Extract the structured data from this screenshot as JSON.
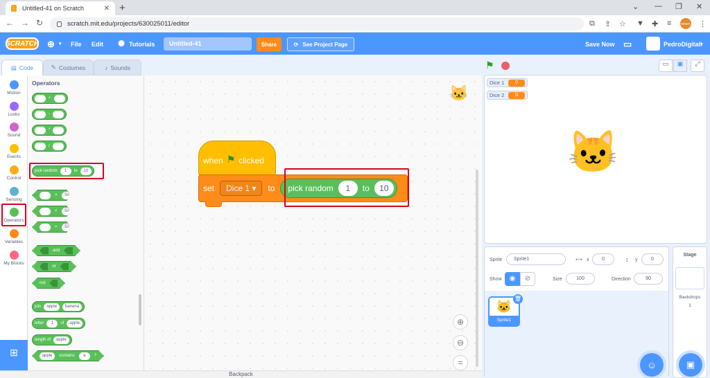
{
  "browser": {
    "tab_title": "Untitled-41 on Scratch",
    "url": "scratch.mit.edu/projects/630025011/editor",
    "profile_badge": "MAMA"
  },
  "menu": {
    "logo": "SCRATCH",
    "file": "File",
    "edit": "Edit",
    "tutorials": "Tutorials",
    "project_title": "Untitled-41",
    "share": "Share",
    "see_project_page": "See Project Page",
    "save_now": "Save Now",
    "username": "PedroDigitali"
  },
  "editor_tabs": {
    "code": "Code",
    "costumes": "Costumes",
    "sounds": "Sounds"
  },
  "categories": [
    {
      "label": "Motion",
      "color": "#4c97ff"
    },
    {
      "label": "Looks",
      "color": "#9966ff"
    },
    {
      "label": "Sound",
      "color": "#cf63cf"
    },
    {
      "label": "Events",
      "color": "#ffbf00"
    },
    {
      "label": "Control",
      "color": "#ffab19"
    },
    {
      "label": "Sensing",
      "color": "#5cb1d6"
    },
    {
      "label": "Operators",
      "color": "#59c059"
    },
    {
      "label": "Variables",
      "color": "#ff8c1a"
    },
    {
      "label": "My Blocks",
      "color": "#ff6680"
    }
  ],
  "palette": {
    "title": "Operators",
    "arith": [
      "+",
      "-",
      "*",
      "/"
    ],
    "pick_random": {
      "label": "pick random",
      "from": "1",
      "to_label": "to",
      "to": "10"
    },
    "compare": [
      {
        "op": ">",
        "value": "50"
      },
      {
        "op": "<",
        "value": "50"
      },
      {
        "op": "=",
        "value": "50"
      }
    ],
    "and": "and",
    "or": "or",
    "not": "not",
    "join": {
      "label": "join",
      "a": "apple",
      "b": "banana"
    },
    "letter": {
      "label": "letter",
      "n": "1",
      "of": "of",
      "word": "apple"
    },
    "length": {
      "label": "length of",
      "word": "apple"
    },
    "contains": {
      "word": "apple",
      "label": "contains",
      "letter": "a",
      "q": "?"
    }
  },
  "script": {
    "when": "when",
    "clicked": "clicked",
    "set": "set",
    "variable": "Dice 1",
    "to": "to",
    "pick_random": "pick random",
    "from": "1",
    "to_label": "to",
    "to_value": "10"
  },
  "backpack": "Backpack",
  "monitors": [
    {
      "name": "Dice 1",
      "value": "0"
    },
    {
      "name": "Dice 2",
      "value": "0"
    }
  ],
  "sprite_info": {
    "sprite_label": "Sprite",
    "sprite_name": "Sprite1",
    "x_label": "x",
    "x": "0",
    "y_label": "y",
    "y": "0",
    "show_label": "Show",
    "size_label": "Size",
    "size": "100",
    "direction_label": "Direction",
    "direction": "90",
    "thumb_label": "Sprite1"
  },
  "stage_panel": {
    "title": "Stage",
    "backdrops_label": "Backdrops",
    "backdrops_count": "1"
  }
}
